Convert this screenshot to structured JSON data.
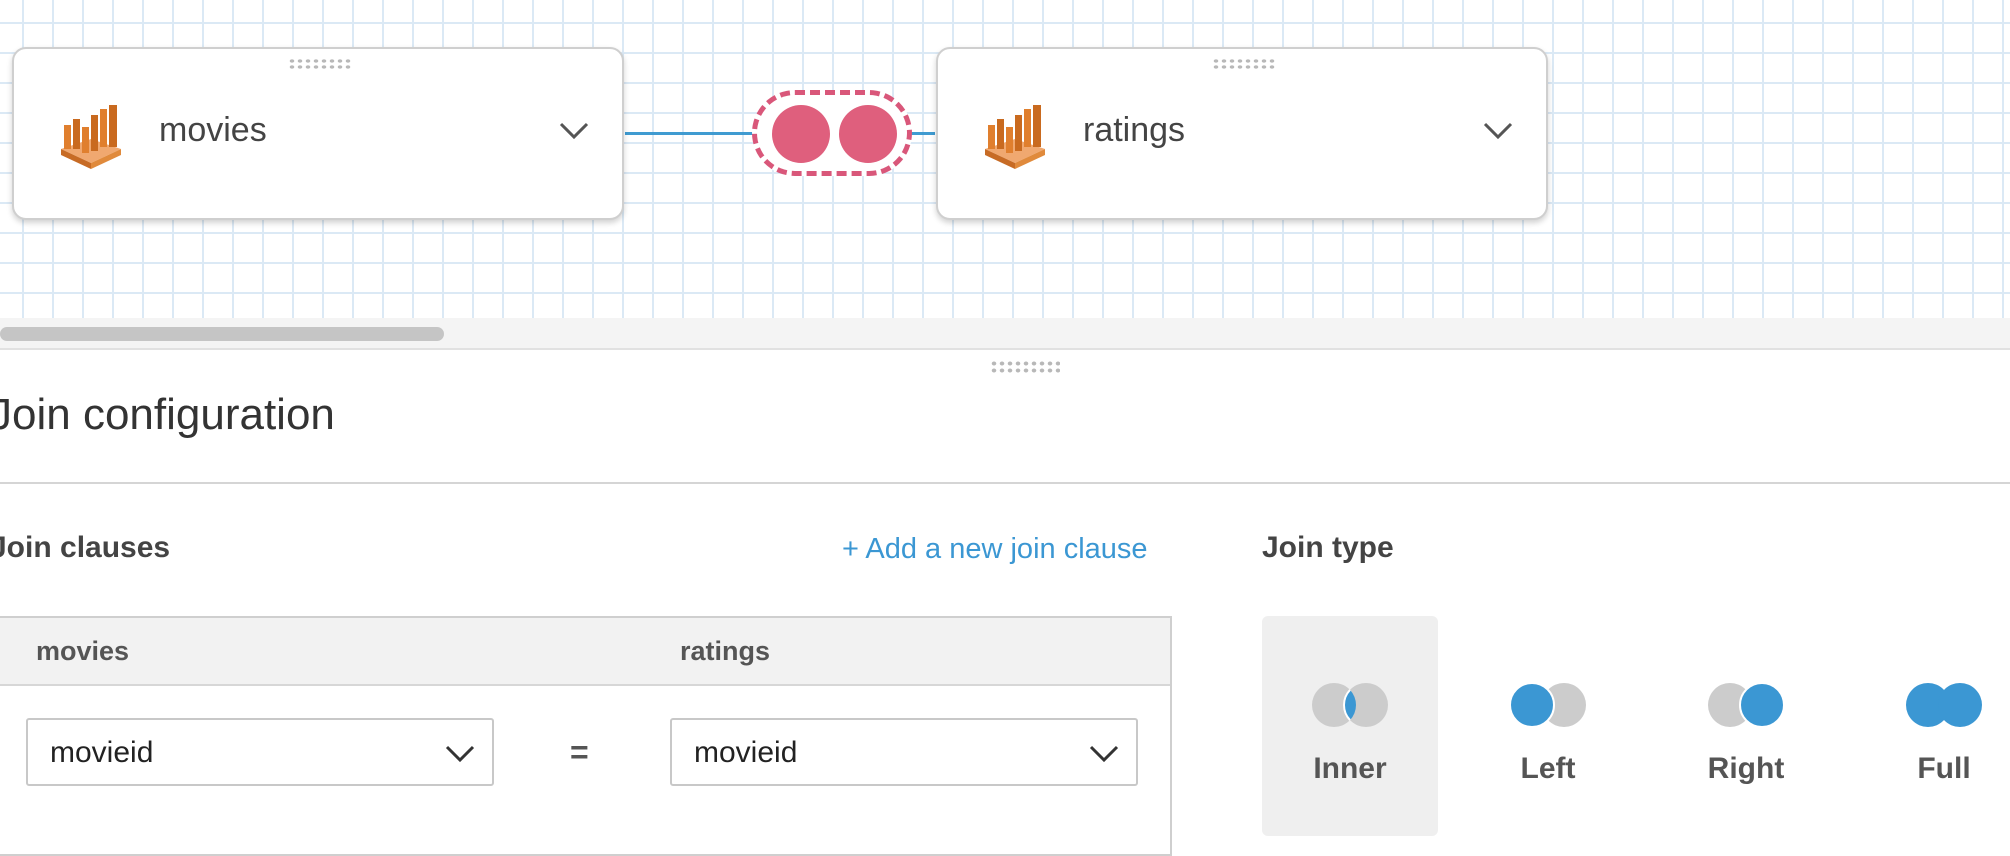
{
  "canvas": {
    "nodes": [
      {
        "name": "movies",
        "icon": "redshift-table-icon"
      },
      {
        "name": "ratings",
        "icon": "redshift-table-icon"
      }
    ],
    "join_icon": "inner-join-icon"
  },
  "panel": {
    "title": "Join configuration",
    "join_clauses": {
      "label": "Join clauses",
      "add_link": "+ Add a new join clause",
      "left_header": "movies",
      "right_header": "ratings",
      "left_value": "movieid",
      "operator": "=",
      "right_value": "movieid"
    },
    "join_type": {
      "label": "Join type",
      "selected": "Inner",
      "options": [
        "Inner",
        "Left",
        "Right",
        "Full"
      ]
    }
  },
  "colors": {
    "accent": "#3b97d3",
    "join_badge": "#df5f7d",
    "venn_active": "#3b97d3",
    "venn_inactive": "#cccccc"
  }
}
